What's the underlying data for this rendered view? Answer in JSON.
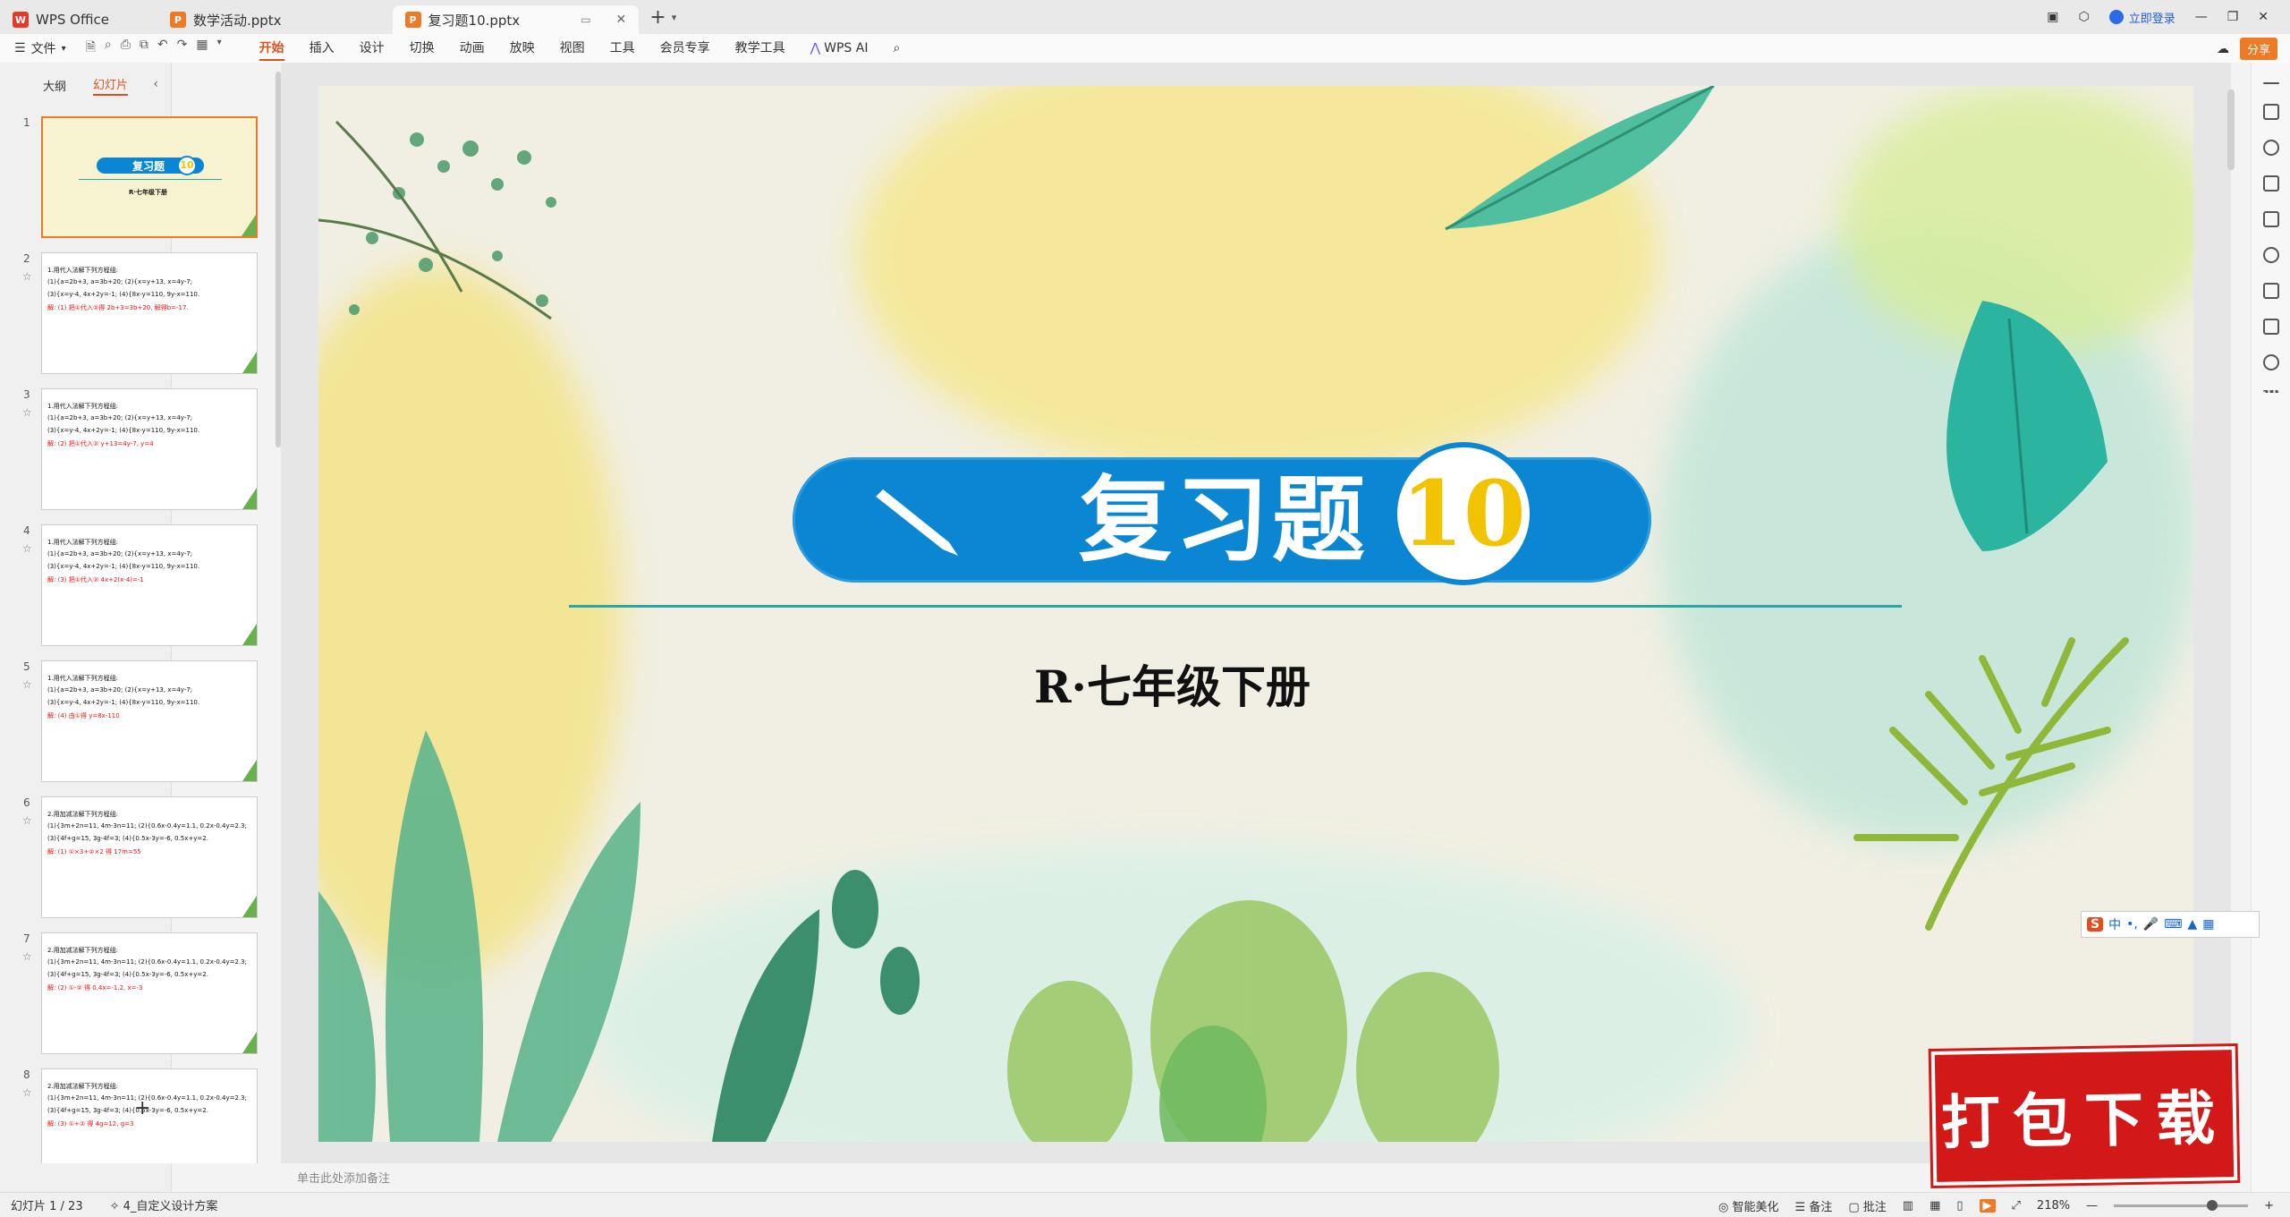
{
  "tabs": [
    {
      "label": "WPS Office",
      "logo": "W",
      "color": "#e33a2c"
    },
    {
      "label": "数学活动.pptx",
      "logo": "P",
      "color": "#ee7a25"
    },
    {
      "label": "复习题10.pptx",
      "logo": "P",
      "color": "#ee7a25",
      "active": true
    }
  ],
  "window": {
    "login": "立即登录"
  },
  "ribbon": {
    "file_menu": "文件",
    "tabs": [
      "开始",
      "插入",
      "设计",
      "切换",
      "动画",
      "放映",
      "视图",
      "工具",
      "会员专享",
      "教学工具",
      "WPS AI"
    ],
    "share": "分享"
  },
  "left_panel": {
    "tabs": [
      "大纲",
      "幻灯片"
    ],
    "slides": [
      {
        "num": "1",
        "kind": "title"
      },
      {
        "num": "2",
        "lines": [
          "1.用代入法解下列方程组:",
          "(1){a=2b+3, a=3b+20;  (2){x=y+13, x=4y-7;",
          "(3){x=y-4, 4x+2y=-1;  (4){8x-y=110, 9y-x=110.",
          "解: (1) 把①代入②得 2b+3=3b+20, 解得b=-17."
        ]
      },
      {
        "num": "3",
        "lines": [
          "1.用代入法解下列方程组:",
          "(1){a=2b+3, a=3b+20;  (2){x=y+13, x=4y-7;",
          "(3){x=y-4, 4x+2y=-1;  (4){8x-y=110, 9y-x=110.",
          "解: (2) 把①代入② y+13=4y-7, y=4"
        ]
      },
      {
        "num": "4",
        "lines": [
          "1.用代入法解下列方程组:",
          "(1){a=2b+3, a=3b+20;  (2){x=y+13, x=4y-7;",
          "(3){x=y-4, 4x+2y=-1;  (4){8x-y=110, 9y-x=110.",
          "解: (3) 把①代入② 4x+2(x-4)=-1"
        ]
      },
      {
        "num": "5",
        "lines": [
          "1.用代入法解下列方程组:",
          "(1){a=2b+3, a=3b+20;  (2){x=y+13, x=4y-7;",
          "(3){x=y-4, 4x+2y=-1;  (4){8x-y=110, 9y-x=110.",
          "解: (4) 由①得 y=8x-110"
        ]
      },
      {
        "num": "6",
        "lines": [
          "2.用加减法解下列方程组:",
          "(1){3m+2n=11, 4m-3n=11;  (2){0.6x-0.4y=1.1, 0.2x-0.4y=2.3;",
          "(3){4f+g=15, 3g-4f=3;  (4){0.5x-3y=-6, 0.5x+y=2.",
          "解: (1) ①×3+②×2 得 17m=55"
        ]
      },
      {
        "num": "7",
        "lines": [
          "2.用加减法解下列方程组:",
          "(1){3m+2n=11, 4m-3n=11;  (2){0.6x-0.4y=1.1, 0.2x-0.4y=2.3;",
          "(3){4f+g=15, 3g-4f=3;  (4){0.5x-3y=-6, 0.5x+y=2.",
          "解: (2) ①-② 得 0.4x=-1.2, x=-3"
        ]
      },
      {
        "num": "8",
        "lines": [
          "2.用加减法解下列方程组:",
          "(1){3m+2n=11, 4m-3n=11;  (2){0.6x-0.4y=1.1, 0.2x-0.4y=2.3;",
          "(3){4f+g=15, 3g-4f=3;  (4){0.5x-3y=-6, 0.5x+y=2.",
          "解: (3) ①+② 得 4g=12, g=3"
        ]
      }
    ]
  },
  "slide": {
    "title": "复习题",
    "number": "10",
    "subtitle": "R·七年级下册"
  },
  "notes_placeholder": "单击此处添加备注",
  "ime": {
    "logo": "S",
    "lang": "中"
  },
  "download_stamp": "打包下载",
  "status": {
    "slide_counter": "幻灯片 1 / 23",
    "design": "4_自定义设计方案",
    "beautify": "智能美化",
    "notes": "备注",
    "comments": "批注",
    "zoom": "218%",
    "zoom_level": 0.73
  }
}
